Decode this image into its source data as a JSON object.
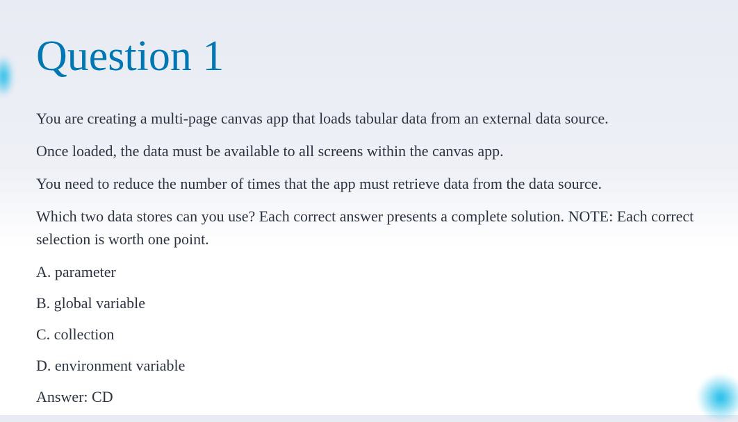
{
  "title": "Question 1",
  "paragraphs": [
    "You are creating a multi-page canvas app that loads tabular data from an external data source.",
    "Once loaded, the data must be available to all screens within the canvas app.",
    "You need to reduce the number of times that the app must retrieve data from the data source.",
    "Which two data stores can you use? Each correct answer presents a complete solution. NOTE: Each correct selection is worth one point."
  ],
  "options": [
    "A. parameter",
    "B. global variable",
    "C. collection",
    "D. environment variable"
  ],
  "answer": "Answer: CD"
}
